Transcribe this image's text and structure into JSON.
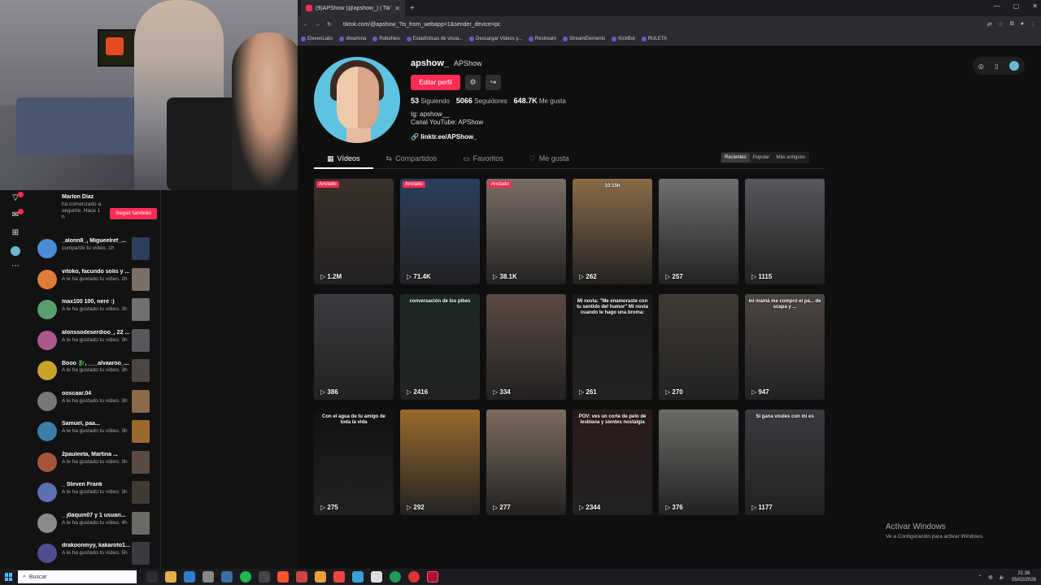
{
  "browser": {
    "tab_title": "(9)APShow (@apshow_) | TikTok",
    "url": "tiktok.com/@apshow_?is_from_webapp=1&sender_device=pc",
    "bookmarks": [
      "ElevenLabs",
      "dreamina",
      "RoboNeo",
      "Estadísticas de visua...",
      "Descargar Videos y...",
      "Restream",
      "StreamElements",
      "KickBot",
      "RULETA"
    ]
  },
  "profile": {
    "username": "apshow_",
    "nickname": "APShow",
    "edit_label": "Editar perfil",
    "following_count": "53",
    "following_label": "Siguiendo",
    "followers_count": "5066",
    "followers_label": "Seguidores",
    "likes_count": "648.7K",
    "likes_label": "Me gusta",
    "bio_line1": "Ig: apshow__",
    "bio_line2": "Canal YouTube: APShow",
    "link": "linktr.ee/APShow_"
  },
  "tabs": {
    "videos": "Vídeos",
    "reposts": "Compartidos",
    "favorites": "Favoritos",
    "liked": "Me gusta"
  },
  "sort": {
    "recent": "Recientes",
    "popular": "Popular",
    "oldest": "Más antiguos"
  },
  "videos": [
    {
      "views": "1.2M",
      "pinned": "Anclado",
      "color": "#3a2f2a"
    },
    {
      "views": "71.4K",
      "pinned": "Anclado",
      "color": "#2b3e5c"
    },
    {
      "views": "38.1K",
      "pinned": "Anclado",
      "color": "#7b6e66"
    },
    {
      "views": "262",
      "caption": "10:15h",
      "color": "#8a6a48"
    },
    {
      "views": "257",
      "color": "#6f6f72"
    },
    {
      "views": "1115",
      "color": "#57575c"
    },
    {
      "views": "386",
      "color": "#3b3b3f"
    },
    {
      "views": "2416",
      "caption": "conversación de los pibes",
      "color": "#1d2a24"
    },
    {
      "views": "334",
      "color": "#5a4a42"
    },
    {
      "views": "261",
      "caption": "Mi novia: \"Me enamoraste con tu sentido del humor\" Mi novia cuando le hago una broma:",
      "color": "#1a1a1a"
    },
    {
      "views": "270",
      "color": "#3f3a34"
    },
    {
      "views": "947",
      "caption": "mi mamá me compró el pa... de scapa y ...",
      "color": "#4c4543"
    },
    {
      "views": "275",
      "caption": "Con el agua de tu amigo de toda la vida",
      "color": "#111"
    },
    {
      "views": "292",
      "color": "#9a6a2c"
    },
    {
      "views": "277",
      "color": "#7b6c5c"
    },
    {
      "views": "2344",
      "caption": "POV: ves un corte de pelo de lesbiana y sientes nostalgia",
      "color": "#2a1a1a"
    },
    {
      "views": "376",
      "color": "#6a6a66"
    },
    {
      "views": "1177",
      "caption": "Si gana voules con mi es",
      "color": "#3a3a3e"
    }
  ],
  "notifications": [
    {
      "name": "Marlon Díaz",
      "text": "ha comenzado a seguirte. Hace 1 h",
      "button": "Seguir también"
    },
    {
      "name": "_alonn8_, Migueelref_...",
      "text": "compartió tu vídeo. 1h"
    },
    {
      "name": "vitoko, facundo solis y ...",
      "text": "A le ha gustado tu vídeo. 2h"
    },
    {
      "name": "max100 100, nere :)",
      "text": "A le ha gustado tu vídeo. 3h"
    },
    {
      "name": "alonssodeserdioo_, 22 ...",
      "text": "A le ha gustado tu vídeo. 3h"
    },
    {
      "name": "Booo 🐉, ___alvaaroo_...",
      "text": "A le ha gustado tu vídeo. 3h"
    },
    {
      "name": "oosсaar.04",
      "text": "A le ha gustado tu vídeo. 3h"
    },
    {
      "name": "Samuel, paa...",
      "text": "A le ha gustado tu vídeo. 3h"
    },
    {
      "name": "2pauleeta, Martina ...",
      "text": "A le ha gustado tu vídeo. 3h"
    },
    {
      "name": "_ Steven Frank",
      "text": "A le ha gustado tu vídeo. 3h"
    },
    {
      "name": "_ j0aquin07 y 1 usuari...",
      "text": "A le ha gustado tu vídeo. 4h"
    },
    {
      "name": "drakoonmyy, kakaroto1...",
      "text": "A le ha gustado tu vídeo. 5h"
    }
  ],
  "windows": {
    "activate_title": "Activar Windows",
    "activate_sub": "Ve a Configuración para activar Windows.",
    "search_placeholder": "Buscar",
    "time": "21:36",
    "date": "05/02/2026"
  }
}
